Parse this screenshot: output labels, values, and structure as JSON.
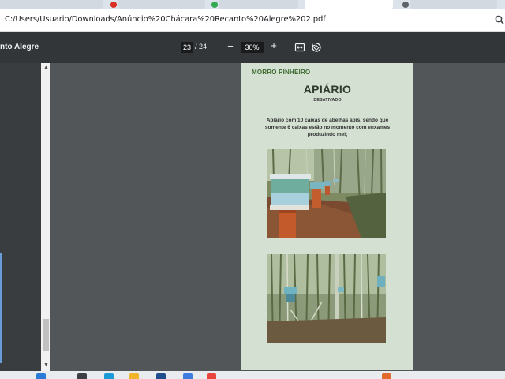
{
  "browser": {
    "url": "C:/Users/Usuario/Downloads/Anúncio%20Chácara%20Recanto%20Alegre%202.pdf"
  },
  "pdf_toolbar": {
    "title": "nto Alegre",
    "current_page": "23",
    "page_total": "/ 24",
    "zoom_minus": "−",
    "zoom_level": "30%",
    "zoom_plus": "+"
  },
  "page": {
    "section_header": "MORRO PINHEIRO",
    "heading": "APIÁRIO",
    "subheading": "DESATIVADO",
    "body": "Apiário com 10 caixas de abelhas apis, sendo que somente 6 caixas estão no momento com enxames produzindo mel;"
  },
  "colors": {
    "page_background": "#d3e0d2",
    "section_header": "#3b6a2f",
    "toolbar": "#323639",
    "viewer_background": "#525659"
  },
  "icons": {
    "zoom_browser": "magnifier-icon",
    "fit_page": "fit-to-page-icon",
    "rotate": "rotate-icon"
  }
}
